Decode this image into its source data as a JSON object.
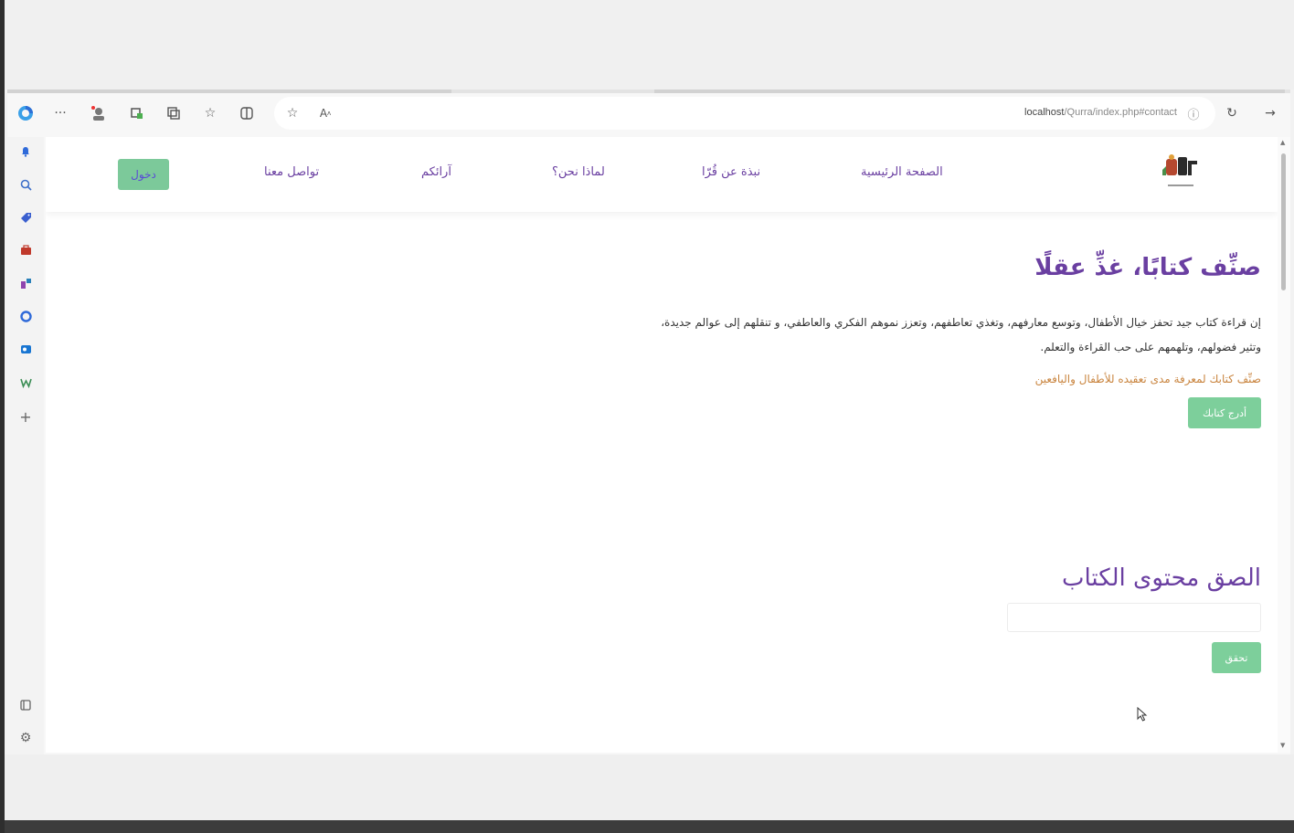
{
  "browser": {
    "address_host": "localhost",
    "address_path": "/Qurra/index.php#contact"
  },
  "site": {
    "nav": {
      "home": "الصفحة الرئيسية",
      "about": "نبذة عن قُرّا",
      "why_us": "لماذا نحن؟",
      "opinions": "آرائكم",
      "contact": "تواصل معنا",
      "login": "دخول"
    },
    "hero": {
      "title": "صنِّف كتابًا، غذِّ عقلًا",
      "description": "إن قراءة كتاب جيد تحفز خيال الأطفال، وتوسع معارفهم، وتغذي تعاطفهم، وتعزز نموهم الفكري والعاطفي، و تنقلهم إلى عوالم جديدة، وتثير فضولهم، وتلهمهم على حب القراءة والتعلم.",
      "note": "صنِّف كتابك لمعرفة مدى تعقيده للأطفال واليافعين",
      "insert_button": "أدرج كتابك"
    },
    "paste": {
      "title": "الصق محتوى الكتاب",
      "input_value": "",
      "verify_button": "تحقق"
    }
  },
  "colors": {
    "brand_purple": "#6a3fa1",
    "accent_green": "#7dcf9b",
    "note_orange": "#c9843e"
  }
}
